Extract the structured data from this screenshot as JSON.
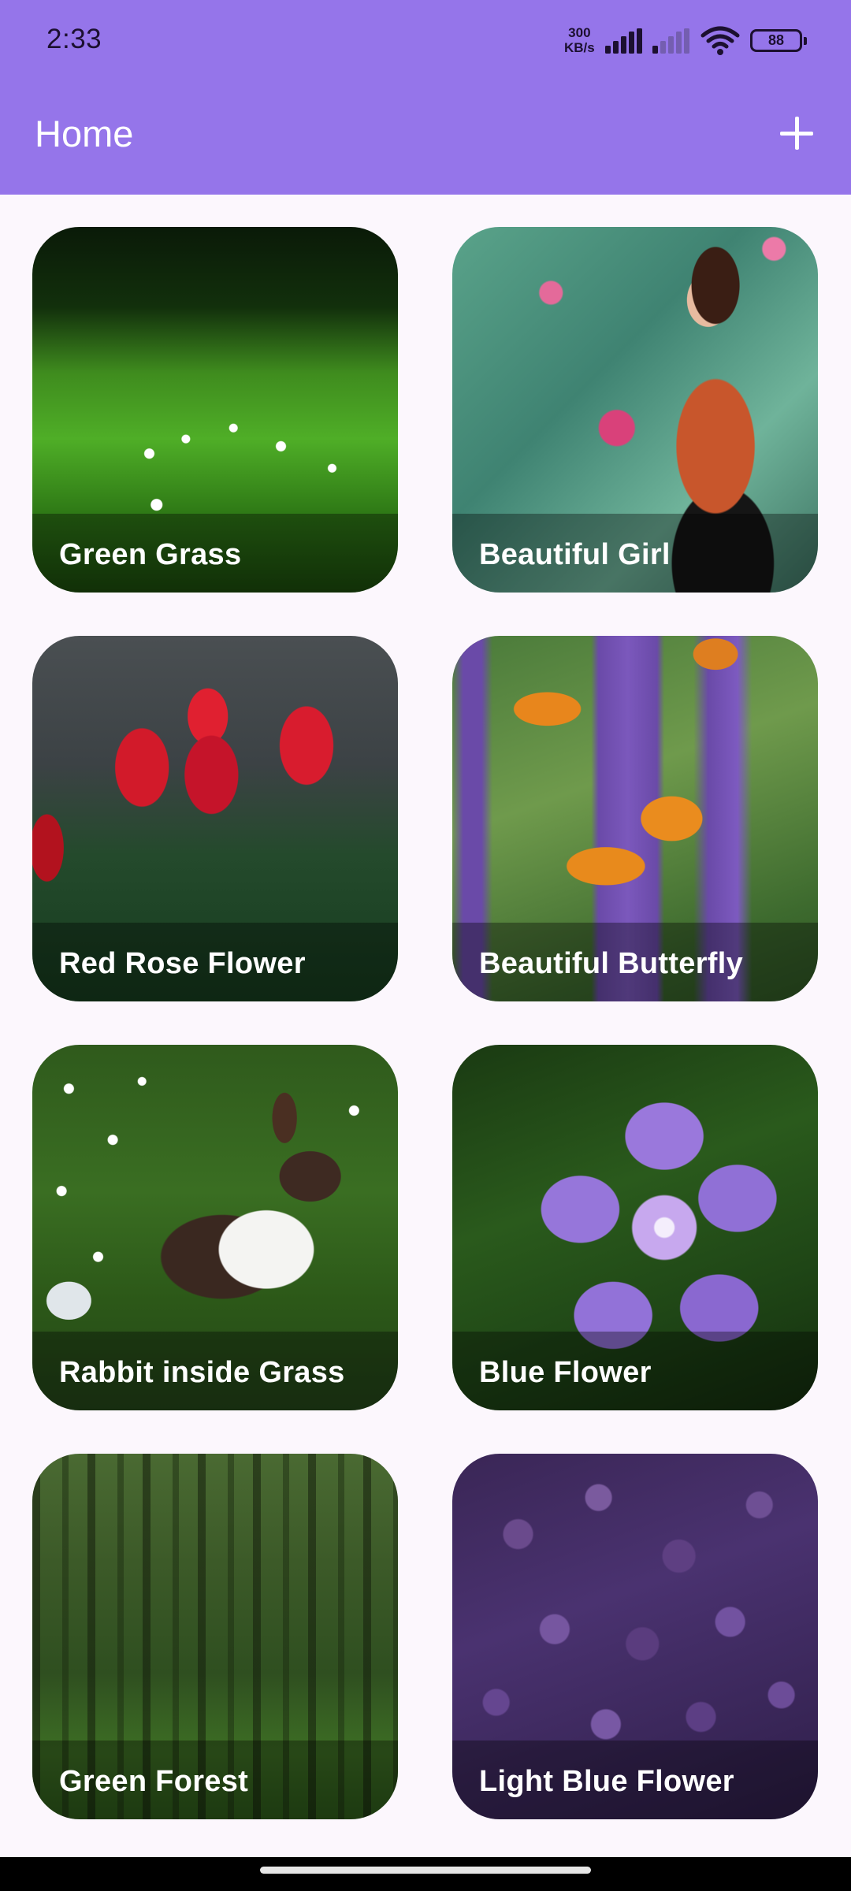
{
  "status_bar": {
    "time": "2:33",
    "net_speed_value": "300",
    "net_speed_unit": "KB/s",
    "battery": "88",
    "icons": [
      "signal-icon",
      "signal-weak-icon",
      "wifi-icon",
      "battery-icon"
    ]
  },
  "app_bar": {
    "title": "Home",
    "add_icon": "plus-icon",
    "color": "#9575ea"
  },
  "cards": [
    {
      "label": "Green Grass"
    },
    {
      "label": "Beautiful Girl"
    },
    {
      "label": "Red Rose Flower"
    },
    {
      "label": "Beautiful Butterfly"
    },
    {
      "label": "Rabbit inside Grass"
    },
    {
      "label": "Blue Flower"
    },
    {
      "label": "Green Forest"
    },
    {
      "label": "Light Blue Flower"
    }
  ]
}
